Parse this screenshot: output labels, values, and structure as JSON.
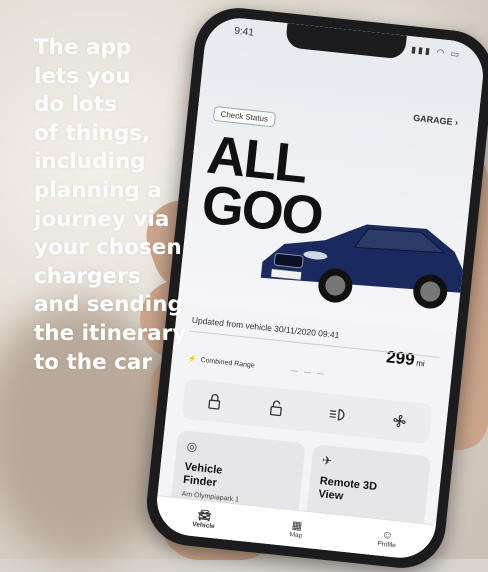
{
  "overlay": {
    "lines": [
      "The app",
      "lets you",
      "do lots",
      "of things,",
      "including",
      "planning a",
      "journey via",
      "your chosen",
      "chargers",
      "and sending",
      "the itinerary",
      "to the car"
    ]
  },
  "status_bar": {
    "time": "9:41"
  },
  "hero": {
    "check_status": "Check Status",
    "garage": "GARAGE",
    "headline_line1": "ALL",
    "headline_line2": "GOO"
  },
  "vehicle": {
    "updated": "Updated from vehicle 30/11/2020 09:41",
    "range_value": "299",
    "range_unit": "mi",
    "range_label": "Combined Range"
  },
  "cards": {
    "finder_title": "Vehicle\nFinder",
    "finder_address": "Am Olympiapark 1",
    "remote_title": "Remote 3D\nView"
  },
  "tabs": [
    "Vehicle",
    "Map",
    "Profile"
  ],
  "colors": {
    "car_body": "#1b2a5e",
    "overlay_text": "#ffffff"
  }
}
